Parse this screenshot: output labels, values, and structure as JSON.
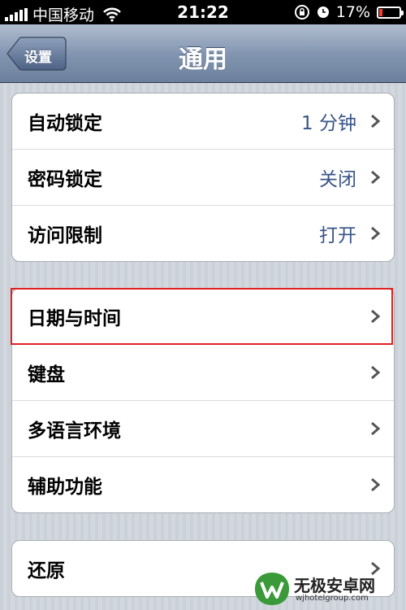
{
  "status_bar": {
    "carrier": "中国移动",
    "time": "21:22",
    "battery": "17%",
    "battery_level": 0.17
  },
  "nav": {
    "back_label": "设置",
    "title": "通用"
  },
  "groups": [
    {
      "rows": [
        {
          "label": "自动锁定",
          "value": "1 分钟"
        },
        {
          "label": "密码锁定",
          "value": "关闭"
        },
        {
          "label": "访问限制",
          "value": "打开"
        }
      ]
    },
    {
      "rows": [
        {
          "label": "日期与时间",
          "value": ""
        },
        {
          "label": "键盘",
          "value": ""
        },
        {
          "label": "多语言环境",
          "value": ""
        },
        {
          "label": "辅助功能",
          "value": ""
        }
      ]
    },
    {
      "rows": [
        {
          "label": "还原",
          "value": ""
        }
      ]
    }
  ],
  "watermark": {
    "name": "无极安卓网",
    "url": "wjhotelgroup.com"
  },
  "colors": {
    "value_text": "#385487",
    "highlight": "#e02020",
    "nav_gradient_top": "#b1bdcf",
    "nav_gradient_bottom": "#6c7f9c"
  }
}
